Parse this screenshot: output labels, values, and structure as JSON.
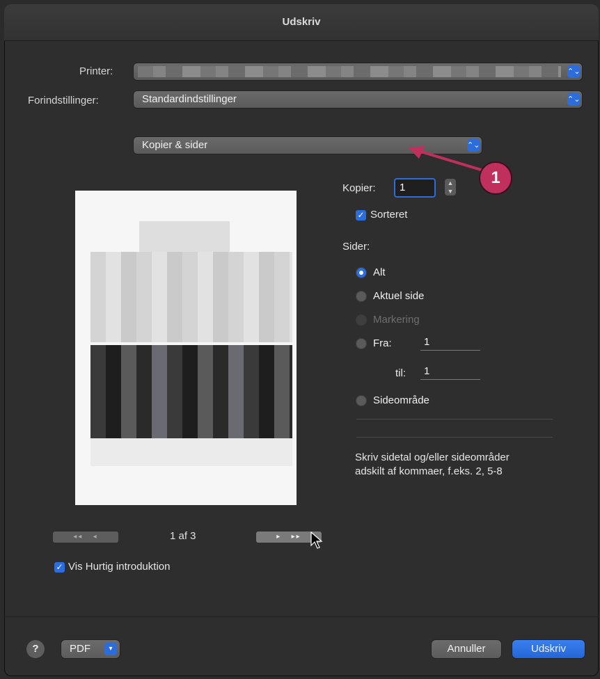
{
  "window": {
    "title": "Udskriv"
  },
  "printer": {
    "label": "Printer:",
    "value": ""
  },
  "presets": {
    "label": "Forindstillinger:",
    "value": "Standardindstillinger"
  },
  "section_popup": {
    "value": "Kopier & sider"
  },
  "annotation": {
    "number": "1"
  },
  "copies": {
    "label": "Kopier:",
    "value": "1",
    "collated_label": "Sorteret",
    "collated": true
  },
  "pages": {
    "label": "Sider:",
    "options": {
      "all": "Alt",
      "current": "Aktuel side",
      "selection": "Markering",
      "from": "Fra:",
      "range": "Sideområde"
    },
    "selected": "all",
    "from_value": "1",
    "to_label": "til:",
    "to_value": "1",
    "help": "Skriv sidetal og/eller sideområder adskilt af kommaer, f.eks. 2, 5-8"
  },
  "preview_nav": {
    "first": "◂◂",
    "prev": "◂",
    "page_text": "1 af 3",
    "next": "▸",
    "last": "▸▸"
  },
  "quick_intro": {
    "label": "Vis Hurtig introduktion",
    "checked": true
  },
  "footer": {
    "help": "?",
    "pdf": "PDF",
    "cancel": "Annuller",
    "print": "Udskriv"
  },
  "colors": {
    "accent": "#2c6cdb",
    "annotation": "#c0305d"
  }
}
